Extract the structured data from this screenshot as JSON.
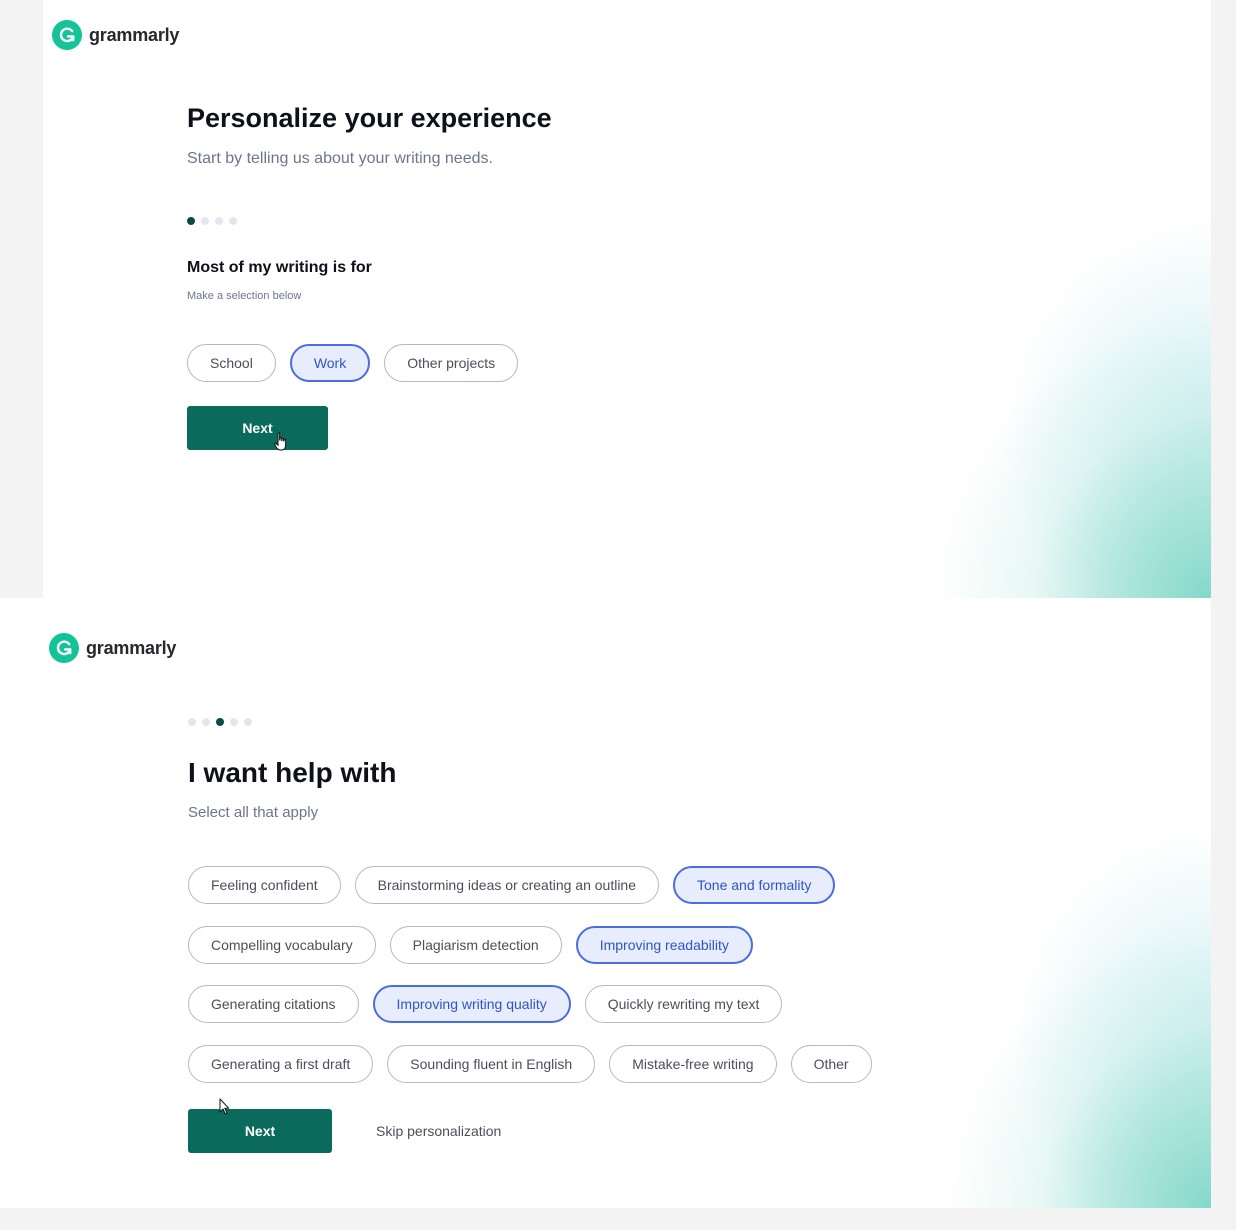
{
  "colors": {
    "brand_green": "#15c39a",
    "button_green": "#0a6a5b",
    "selected_chip_bg": "#e7edfc",
    "selected_chip_border": "#4a6ee0",
    "active_dot": "#0c4b43"
  },
  "screen1": {
    "logo": {
      "icon": "grammarly-g-icon",
      "text": "grammarly"
    },
    "title": "Personalize your experience",
    "subtitle": "Start by telling us about your writing needs.",
    "progress": {
      "total_steps": 4,
      "current_step": 1
    },
    "question": "Most of my writing is for",
    "hint": "Make a selection below",
    "options": [
      {
        "label": "School",
        "selected": false
      },
      {
        "label": "Work",
        "selected": true
      },
      {
        "label": "Other projects",
        "selected": false
      }
    ],
    "next_label": "Next",
    "cursor_icon": "hand-pointer-icon"
  },
  "screen2": {
    "logo": {
      "icon": "grammarly-g-icon",
      "text": "grammarly"
    },
    "progress": {
      "total_steps": 5,
      "current_step": 3
    },
    "title": "I want help with",
    "subtitle": "Select all that apply",
    "option_rows": [
      [
        {
          "label": "Feeling confident",
          "selected": false
        },
        {
          "label": "Brainstorming ideas or creating an outline",
          "selected": false
        },
        {
          "label": "Tone and formality",
          "selected": true
        }
      ],
      [
        {
          "label": "Compelling vocabulary",
          "selected": false
        },
        {
          "label": "Plagiarism detection",
          "selected": false
        },
        {
          "label": "Improving readability",
          "selected": true
        }
      ],
      [
        {
          "label": "Generating citations",
          "selected": false
        },
        {
          "label": "Improving writing quality",
          "selected": true
        },
        {
          "label": "Quickly rewriting my text",
          "selected": false
        }
      ],
      [
        {
          "label": "Generating a first draft",
          "selected": false
        },
        {
          "label": "Sounding fluent in English",
          "selected": false
        },
        {
          "label": "Mistake-free writing",
          "selected": false
        },
        {
          "label": "Other",
          "selected": false
        }
      ]
    ],
    "next_label": "Next",
    "skip_label": "Skip personalization",
    "cursor_icon": "arrow-pointer-icon"
  }
}
